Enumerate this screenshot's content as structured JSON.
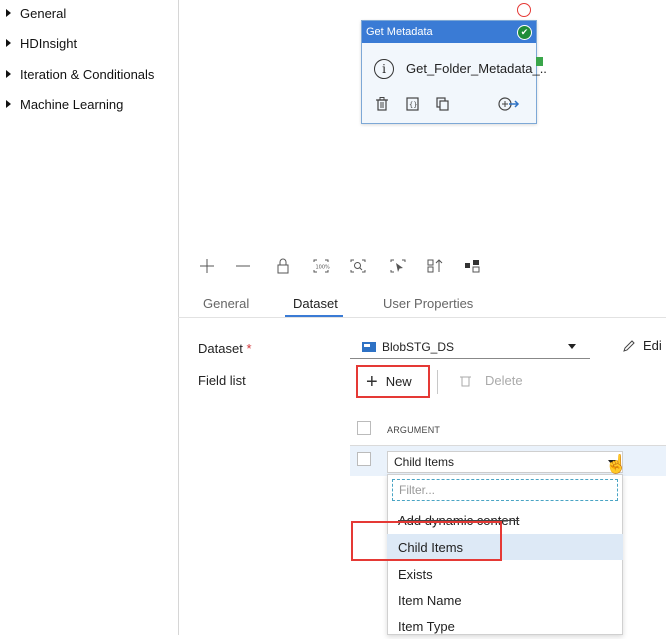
{
  "activities_panel": {
    "items": [
      {
        "label": "General"
      },
      {
        "label": "HDInsight"
      },
      {
        "label": "Iteration & Conditionals"
      },
      {
        "label": "Machine Learning"
      }
    ]
  },
  "activity_card": {
    "title": "Get Metadata",
    "name": "Get_Folder_Metadata_..",
    "status": "succeeded",
    "header_color": "#3a7bd5"
  },
  "canvas_toolbar": {
    "icons": [
      "zoom-in-icon",
      "zoom-out-icon",
      "lock-icon",
      "zoom-100-icon",
      "zoom-to-fit-icon",
      "select-icon",
      "auto-align-icon",
      "layout-icon"
    ]
  },
  "tabs": [
    {
      "label": "General"
    },
    {
      "label": "Dataset",
      "active": true
    },
    {
      "label": "User Properties"
    }
  ],
  "dataset_tab": {
    "dataset_label": "Dataset",
    "required_mark": "*",
    "dataset_value": "BlobSTG_DS",
    "edit_label": "Edi",
    "field_list_label": "Field list",
    "new_label": "New",
    "delete_label": "Delete",
    "argument_header": "ARGUMENT",
    "argument_value": "Child Items",
    "filter_placeholder": "Filter...",
    "options": [
      {
        "label": "Add dynamic content"
      },
      {
        "label": "Child Items",
        "selected": true
      },
      {
        "label": "Exists"
      },
      {
        "label": "Item Name"
      },
      {
        "label": "Item Type"
      }
    ]
  },
  "highlight_color": "#e53935"
}
